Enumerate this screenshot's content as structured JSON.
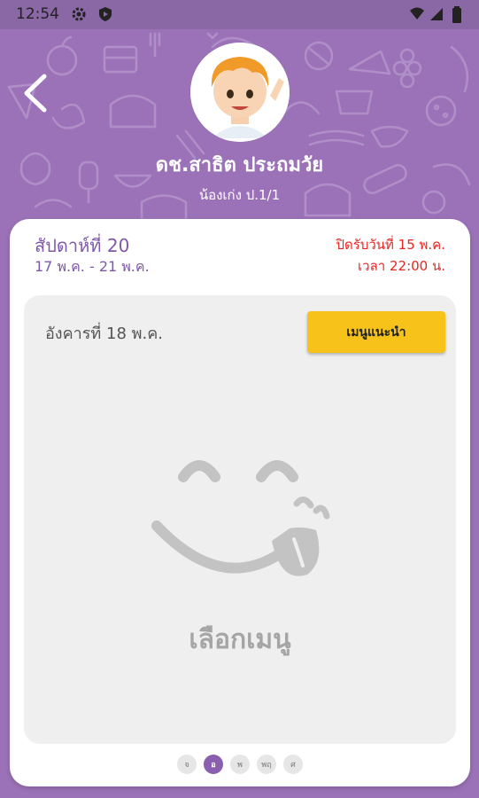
{
  "status_bar": {
    "time": "12:54",
    "icons": [
      "gear-icon",
      "play-shield-icon",
      "wifi-icon",
      "signal-icon",
      "battery-icon"
    ]
  },
  "header": {
    "teacher_name": "ดช.สาธิต ประถมวัย",
    "student_name": "น้องเก่ง ป.1/1"
  },
  "week": {
    "title": "สัปดาห์ที่ 20",
    "range": "17 พ.ค. - 21 พ.ค.",
    "close_date": "ปิดรับวันที่ 15 พ.ค.",
    "close_time": "เวลา 22:00 น."
  },
  "day_panel": {
    "day_label": "อังคารที่ 18 พ.ค.",
    "recommend_label": "เมนูแนะนำ",
    "select_menu_label": "เลือกเมนู"
  },
  "day_tabs": [
    {
      "label": "จ",
      "active": false
    },
    {
      "label": "อ",
      "active": true
    },
    {
      "label": "พ",
      "active": false
    },
    {
      "label": "พฤ",
      "active": false
    },
    {
      "label": "ศ",
      "active": false
    }
  ],
  "colors": {
    "primary": "#9b72b8",
    "accent": "#f7c21a",
    "deadline": "#e52520",
    "week_text": "#7f58a8"
  }
}
